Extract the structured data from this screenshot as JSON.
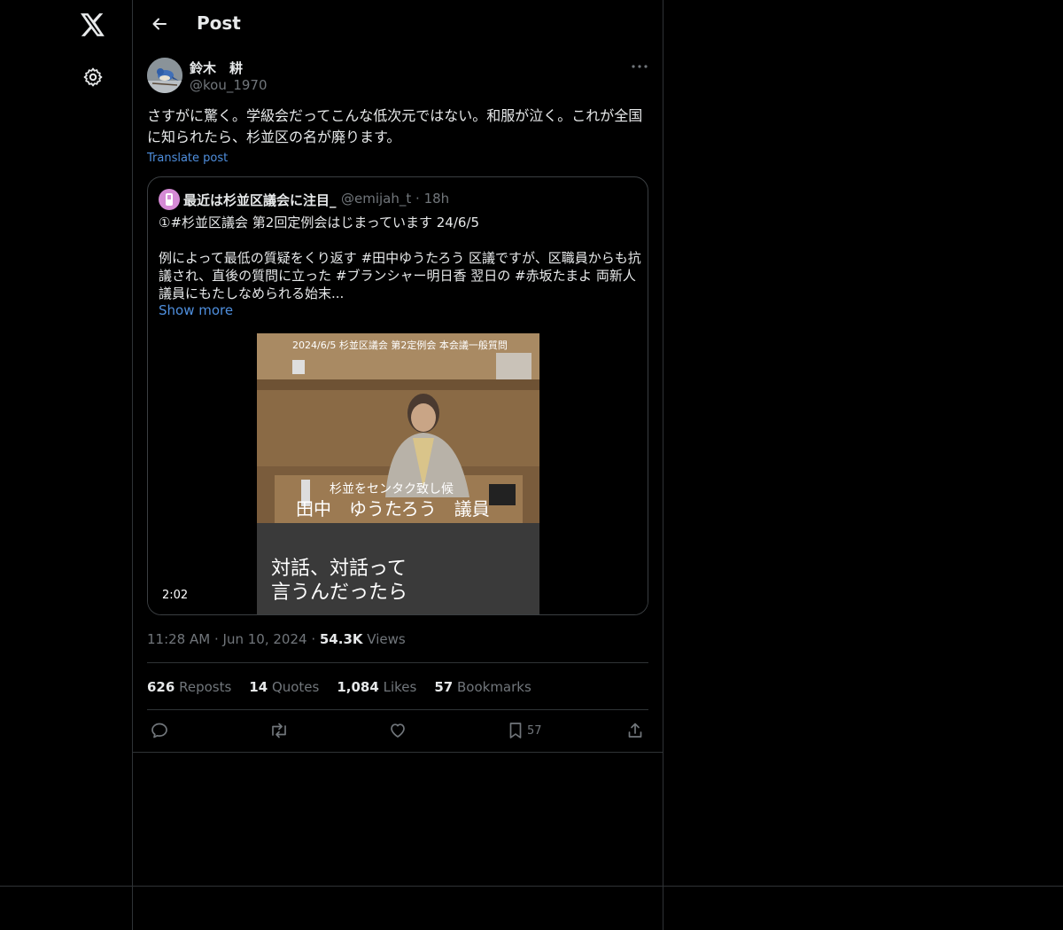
{
  "nav": {
    "logo_icon": "x-logo-icon",
    "settings_icon": "gear-icon"
  },
  "header": {
    "title": "Post",
    "back_icon": "arrow-left-icon"
  },
  "post": {
    "author_name": "鈴木　耕",
    "author_handle": "@kou_1970",
    "text": "さすがに驚く。学級会だってこんな低次元ではない。和服が泣く。これが全国に知られたら、杉並区の名が廃ります。",
    "translate_label": "Translate post",
    "more_icon": "more-icon"
  },
  "quote": {
    "author_name": "最近は杉並区議会に注目_",
    "author_handle": "@emijah_t",
    "time": "18h",
    "text": "①#杉並区議会 第2回定例会はじまっています 24/6/5\n\n例によって最低の質疑をくり返す #田中ゆうたろう 区議ですが、区職員からも抗議され、直後の質問に立った #ブランシャー明日香 翌日の #赤坂たまよ 両新人議員にもたしなめられる始末...",
    "show_more": "Show more",
    "video": {
      "overlay_top": "2024/6/5 杉並区議会 第2定例会 本会議一般質問",
      "caption_small": "杉並をセンタク致し候",
      "caption_name": "田中　ゆうたろう　議員",
      "subtitle_line1": "対話、対話って",
      "subtitle_line2": "言うんだったら",
      "duration": "2:02"
    }
  },
  "meta": {
    "time": "11:28 AM",
    "date": "Jun 10, 2024",
    "views_count": "54.3K",
    "views_label": "Views"
  },
  "stats": {
    "reposts_count": "626",
    "reposts_label": "Reposts",
    "quotes_count": "14",
    "quotes_label": "Quotes",
    "likes_count": "1,084",
    "likes_label": "Likes",
    "bookmarks_count": "57",
    "bookmarks_label": "Bookmarks"
  },
  "actions": {
    "reply_icon": "reply-icon",
    "repost_icon": "repost-icon",
    "like_icon": "heart-icon",
    "bookmark_icon": "bookmark-icon",
    "bookmark_count": "57",
    "share_icon": "share-icon"
  },
  "colors": {
    "background": "#000000",
    "text": "#e7e9ea",
    "muted": "#71767b",
    "link": "#4f8fde",
    "border": "#2f3336"
  }
}
